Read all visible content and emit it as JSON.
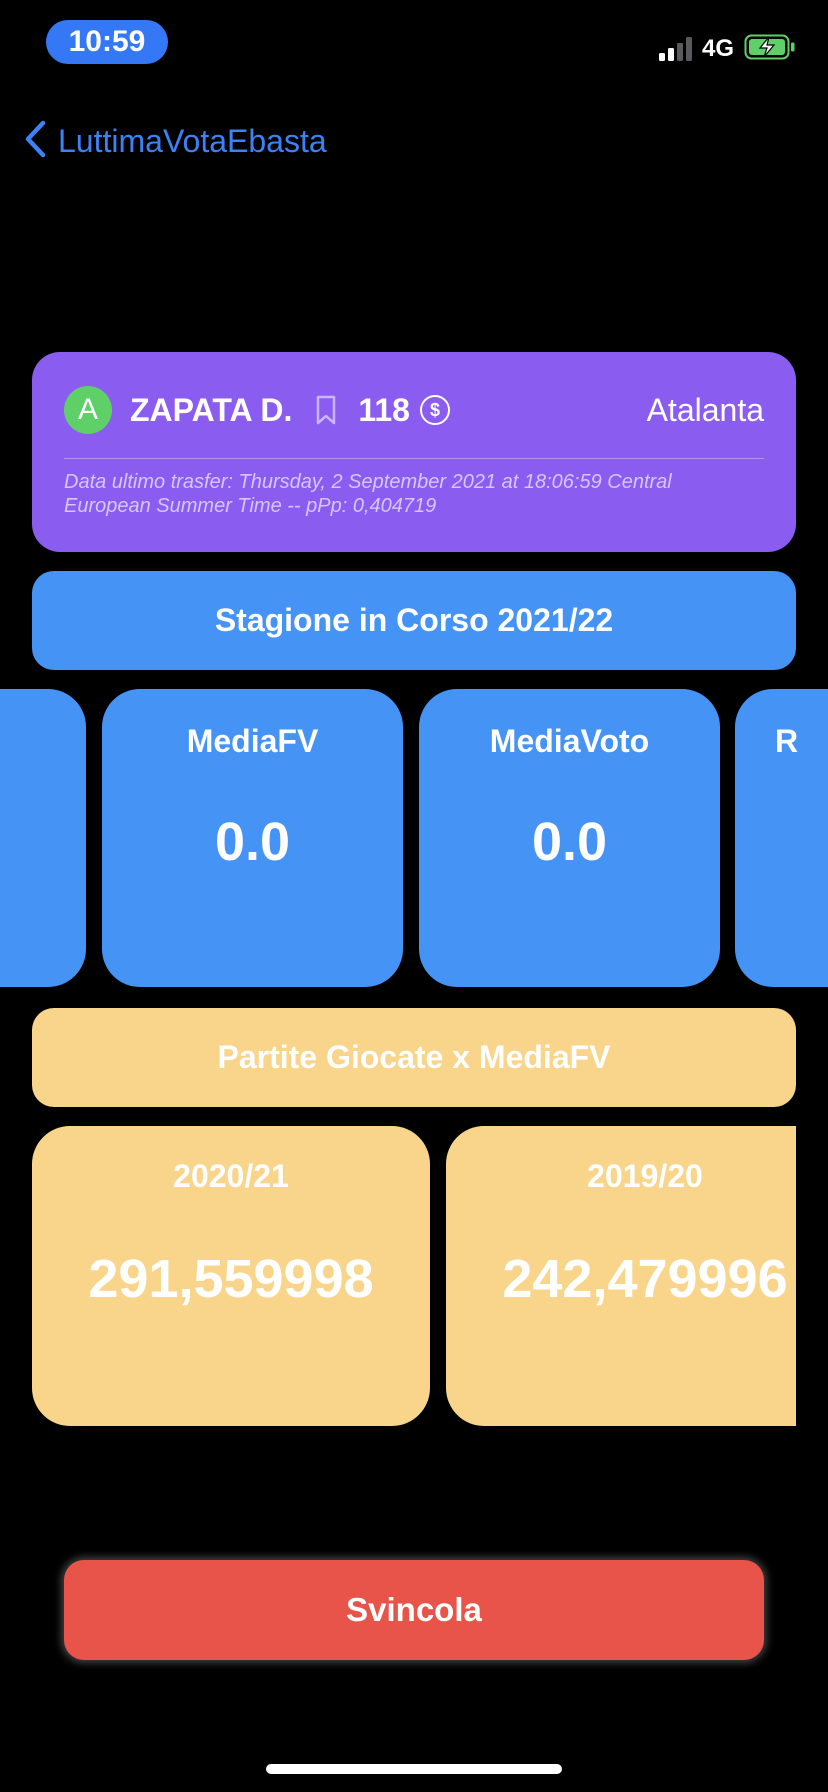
{
  "status_bar": {
    "time": "10:59",
    "network": "4G",
    "signal_bars_filled": 2,
    "signal_bars_total": 4,
    "battery_state": "charging"
  },
  "nav": {
    "back_label": "LuttimaVotaEbasta"
  },
  "player": {
    "role": "A",
    "name": "ZAPATA D.",
    "price": "118",
    "coin_symbol": "$",
    "team": "Atalanta",
    "transfer_info": "Data ultimo trasfer: Thursday, 2 September 2021 at 18:06:59 Central European Summer Time -- pPp: 0,404719"
  },
  "season": {
    "title": "Stagione in Corso 2021/22",
    "stats": [
      {
        "label": "MediaFV",
        "value": "0.0"
      },
      {
        "label": "MediaVoto",
        "value": "0.0"
      }
    ],
    "partial_next_label": "R"
  },
  "history": {
    "title": "Partite Giocate x MediaFV",
    "items": [
      {
        "season": "2020/21",
        "value": "291,559998"
      },
      {
        "season": "2019/20",
        "value": "242,479996"
      }
    ]
  },
  "actions": {
    "release_label": "Svincola"
  },
  "colors": {
    "background": "#000000",
    "time_pill": "#3478f6",
    "link_blue": "#3b82f6",
    "player_card": "#8b5cf0",
    "role_badge": "#5fd068",
    "season_blue": "#4493f5",
    "history_yellow": "#f8d58a",
    "release_red": "#e8544a",
    "battery_green": "#5fd068"
  }
}
